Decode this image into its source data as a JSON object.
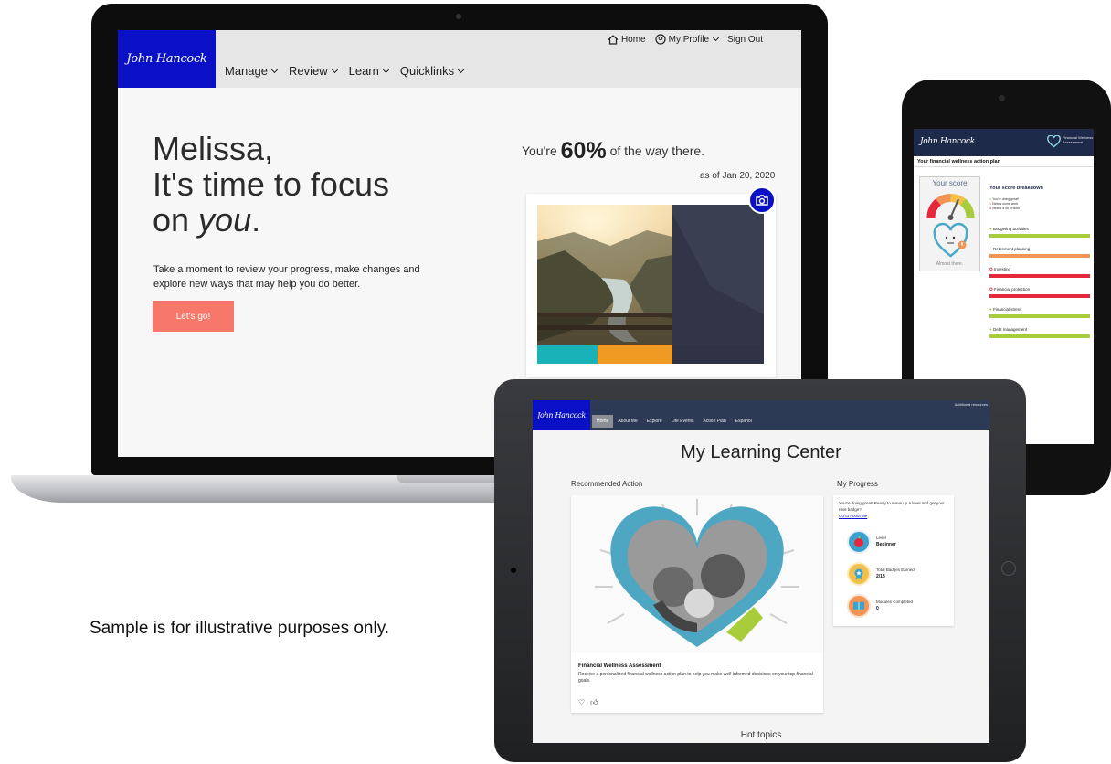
{
  "caption": "Sample is for illustrative purposes only.",
  "laptop": {
    "logo": "John Hancock",
    "top_links": {
      "home": "Home",
      "profile": "My Profile",
      "sign_out": "Sign Out"
    },
    "menu": [
      "Manage",
      "Review",
      "Learn",
      "Quicklinks"
    ],
    "hero": {
      "line1": "Melissa,",
      "line2": "It's time to focus",
      "line3_prefix": "on ",
      "line3_em": "you",
      "line3_suffix": "."
    },
    "subtext": "Take a moment to review your progress, make changes and explore new ways that may help you do better.",
    "cta": "Let's go!",
    "progress": {
      "prefix": "You're ",
      "percent": "60%",
      "suffix": " of the way there.",
      "as_of": "as of Jan 20, 2020"
    }
  },
  "phone": {
    "logo": "John Hancock",
    "brand": "Financial Wellness Assessment",
    "title": "Your financial wellness action plan",
    "score_title": "Your score",
    "score_status": "Almost there.",
    "breakdown_title": "Your score breakdown",
    "legend": [
      "You're doing great!",
      "Needs some work",
      "Needs a lot of work"
    ],
    "categories": [
      {
        "label": "Budgeting activities",
        "status": "great",
        "color": "#a8cc3a"
      },
      {
        "label": "Retirement planning",
        "status": "some",
        "color": "#f39454"
      },
      {
        "label": "Investing",
        "status": "lot",
        "color": "#e5283c"
      },
      {
        "label": "Financial protection",
        "status": "lot",
        "color": "#e5283c"
      },
      {
        "label": "Financial stress",
        "status": "great",
        "color": "#a8cc3a"
      },
      {
        "label": "Debt management",
        "status": "great",
        "color": "#a8cc3a"
      }
    ]
  },
  "tablet": {
    "logo": "John Hancock",
    "additional": "Additional resources",
    "menu": [
      "Home",
      "About Me",
      "Explore",
      "Life Events",
      "Action Plan",
      "Español"
    ],
    "title": "My Learning Center",
    "recommended": "Recommended Action",
    "my_progress": "My Progress",
    "card_title": "Financial Wellness Assessment",
    "card_desc": "Receive a personalized financial wellness action plan to help you make well-informed decisions on your top financial goals.",
    "progress_msg": "You're doing great! Ready to move up a level and get your next badge?",
    "progress_link": "Go to About Me",
    "stats": [
      {
        "label": "Level",
        "value": "Beginner"
      },
      {
        "label": "Total Badges Earned",
        "value": "2/15"
      },
      {
        "label": "Modules Completed",
        "value": "0"
      }
    ],
    "hot_topics": "Hot topics"
  },
  "colors": {
    "brand_blue": "#0a10c6",
    "cta_coral": "#f7786a",
    "navy": "#1e2a4a"
  }
}
